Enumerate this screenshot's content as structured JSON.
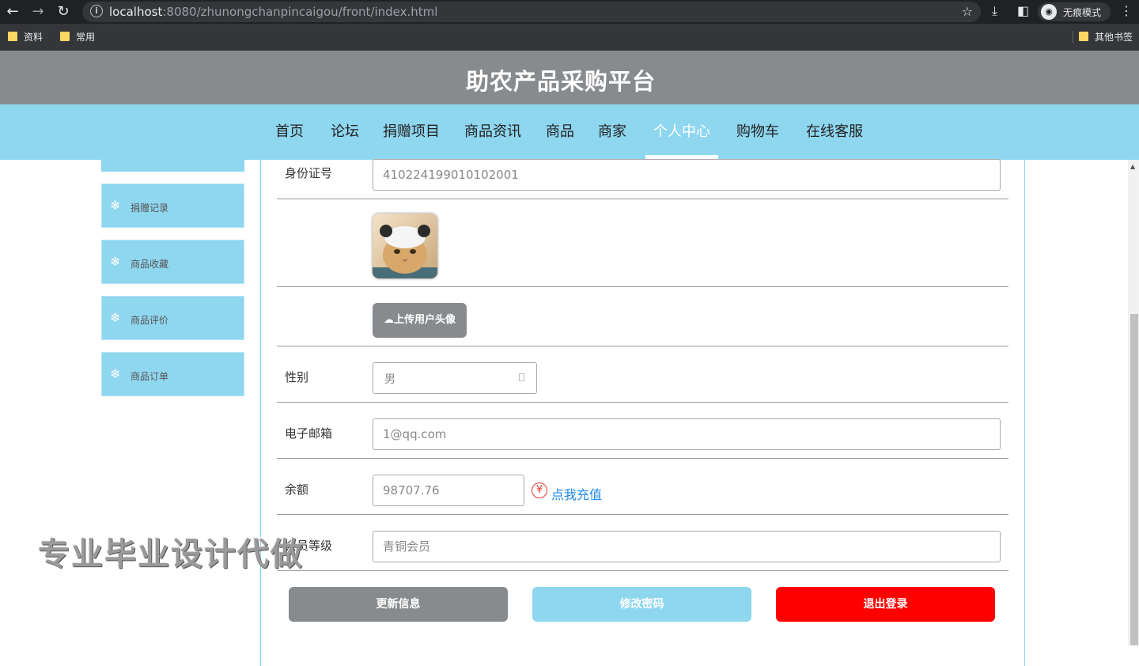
{
  "browser": {
    "url_host": "localhost",
    "url_path": ":8080/zhunongchanpincaigou/front/index.html",
    "incognito_label": "无痕模式",
    "bookmarks": [
      "资料",
      "常用"
    ],
    "other_bookmarks": "其他书签"
  },
  "site": {
    "title": "助农产品采购平台",
    "nav": [
      "首页",
      "论坛",
      "捐赠项目",
      "商品资讯",
      "商品",
      "商家",
      "个人中心",
      "购物车",
      "在线客服"
    ],
    "active_nav": "个人中心"
  },
  "sidebar": {
    "items": [
      {
        "label": "捐赠记录",
        "icon": "snowflake-icon"
      },
      {
        "label": "商品收藏",
        "icon": "snowflake-icon"
      },
      {
        "label": "商品评价",
        "icon": "snowflake-icon"
      },
      {
        "label": "商品订单",
        "icon": "snowflake-icon"
      }
    ]
  },
  "form": {
    "id_card": {
      "label": "身份证号",
      "value": "410224199010102001"
    },
    "upload_label": "上传用户头像",
    "gender": {
      "label": "性别",
      "value": "男"
    },
    "email": {
      "label": "电子邮箱",
      "value": "1@qq.com"
    },
    "balance": {
      "label": "余额",
      "value": "98707.76",
      "recharge": "点我充值",
      "currency_icon": "¥"
    },
    "member_level": {
      "label": "会员等级",
      "value": "青铜会员"
    }
  },
  "actions": {
    "update": "更新信息",
    "change_password": "修改密码",
    "logout": "退出登录"
  },
  "watermark": "专业毕业设计代做",
  "colors": {
    "header_gray": "#888b8e",
    "nav_blue": "#8fd6ef",
    "logout_red": "#ff0000",
    "link_blue": "#1e88e5"
  }
}
